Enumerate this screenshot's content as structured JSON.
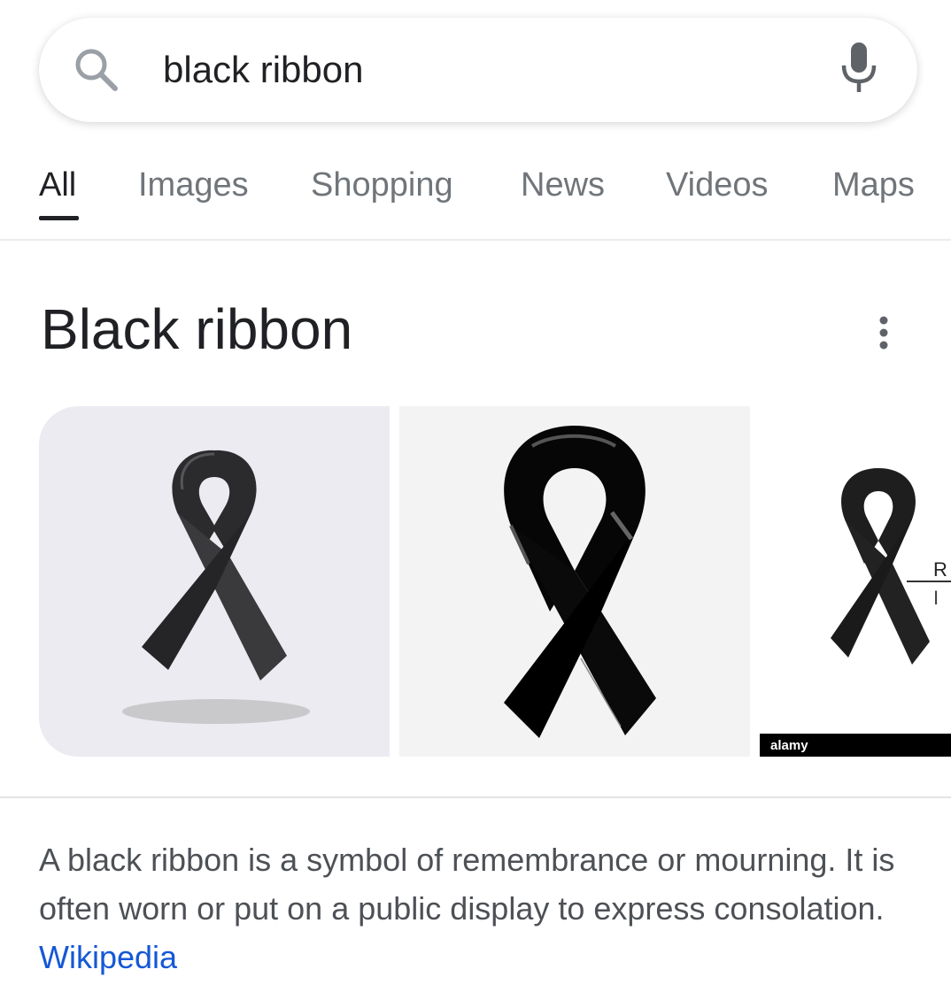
{
  "search": {
    "query": "black ribbon",
    "icon": "search-icon",
    "mic_icon": "mic-icon"
  },
  "tabs": [
    {
      "label": "All",
      "active": true
    },
    {
      "label": "Images",
      "active": false
    },
    {
      "label": "Shopping",
      "active": false
    },
    {
      "label": "News",
      "active": false
    },
    {
      "label": "Videos",
      "active": false
    },
    {
      "label": "Maps",
      "active": false
    }
  ],
  "knowledge_panel": {
    "title": "Black ribbon",
    "more_icon": "more-vert-icon",
    "images": [
      {
        "name": "ribbon-image-1"
      },
      {
        "name": "ribbon-image-2"
      },
      {
        "name": "ribbon-image-3",
        "watermark": "alamy"
      }
    ],
    "description": "A black ribbon is a symbol of remembrance or mourning. It is often worn or put on a public display to express consolation. ",
    "source_link": "Wikipedia"
  },
  "colors": {
    "link": "#1558d6",
    "text_primary": "#202124",
    "text_secondary": "#70757a"
  }
}
